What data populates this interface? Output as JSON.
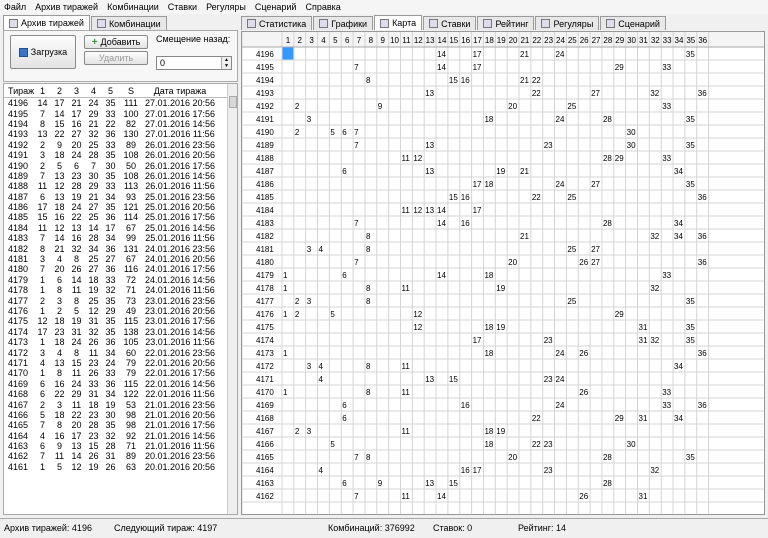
{
  "menu": [
    "Файл",
    "Архив тиражей",
    "Комбинации",
    "Ставки",
    "Регуляры",
    "Сценарий",
    "Справка"
  ],
  "left_tabs": [
    {
      "label": "Архив тиражей",
      "active": true
    },
    {
      "label": "Комбинации",
      "active": false
    }
  ],
  "toolbar": {
    "load_label": "Загрузка",
    "add_label": "Добавить",
    "delete_label": "Удалить",
    "offset_label": "Смещение назад:",
    "offset_value": "0"
  },
  "draw_header": [
    "Тираж",
    "1",
    "2",
    "3",
    "4",
    "5",
    "S",
    "Дата тиража"
  ],
  "draws": [
    [
      "4196",
      "14",
      "17",
      "21",
      "24",
      "35",
      "111",
      "27.01.2016 20:56"
    ],
    [
      "4195",
      "7",
      "14",
      "17",
      "29",
      "33",
      "100",
      "27.01.2016 17:56"
    ],
    [
      "4194",
      "8",
      "15",
      "16",
      "21",
      "22",
      "82",
      "27.01.2016 14:56"
    ],
    [
      "4193",
      "13",
      "22",
      "27",
      "32",
      "36",
      "130",
      "27.01.2016 11:56"
    ],
    [
      "4192",
      "2",
      "9",
      "20",
      "25",
      "33",
      "89",
      "26.01.2016 23:56"
    ],
    [
      "4191",
      "3",
      "18",
      "24",
      "28",
      "35",
      "108",
      "26.01.2016 20:56"
    ],
    [
      "4190",
      "2",
      "5",
      "6",
      "7",
      "30",
      "50",
      "26.01.2016 17:56"
    ],
    [
      "4189",
      "7",
      "13",
      "23",
      "30",
      "35",
      "108",
      "26.01.2016 14:56"
    ],
    [
      "4188",
      "11",
      "12",
      "28",
      "29",
      "33",
      "113",
      "26.01.2016 11:56"
    ],
    [
      "4187",
      "6",
      "13",
      "19",
      "21",
      "34",
      "93",
      "25.01.2016 23:56"
    ],
    [
      "4186",
      "17",
      "18",
      "24",
      "27",
      "35",
      "121",
      "25.01.2016 20:56"
    ],
    [
      "4185",
      "15",
      "16",
      "22",
      "25",
      "36",
      "114",
      "25.01.2016 17:56"
    ],
    [
      "4184",
      "11",
      "12",
      "13",
      "14",
      "17",
      "67",
      "25.01.2016 14:56"
    ],
    [
      "4183",
      "7",
      "14",
      "16",
      "28",
      "34",
      "99",
      "25.01.2016 11:56"
    ],
    [
      "4182",
      "8",
      "21",
      "32",
      "34",
      "36",
      "131",
      "24.01.2016 23:56"
    ],
    [
      "4181",
      "3",
      "4",
      "8",
      "25",
      "27",
      "67",
      "24.01.2016 20:56"
    ],
    [
      "4180",
      "7",
      "20",
      "26",
      "27",
      "36",
      "116",
      "24.01.2016 17:56"
    ],
    [
      "4179",
      "1",
      "6",
      "14",
      "18",
      "33",
      "72",
      "24.01.2016 14:56"
    ],
    [
      "4178",
      "1",
      "8",
      "11",
      "19",
      "32",
      "71",
      "24.01.2016 11:56"
    ],
    [
      "4177",
      "2",
      "3",
      "8",
      "25",
      "35",
      "73",
      "23.01.2016 23:56"
    ],
    [
      "4176",
      "1",
      "2",
      "5",
      "12",
      "29",
      "49",
      "23.01.2016 20:56"
    ],
    [
      "4175",
      "12",
      "18",
      "19",
      "31",
      "35",
      "115",
      "23.01.2016 17:56"
    ],
    [
      "4174",
      "17",
      "23",
      "31",
      "32",
      "35",
      "138",
      "23.01.2016 14:56"
    ],
    [
      "4173",
      "1",
      "18",
      "24",
      "26",
      "36",
      "105",
      "23.01.2016 11:56"
    ],
    [
      "4172",
      "3",
      "4",
      "8",
      "11",
      "34",
      "60",
      "22.01.2016 23:56"
    ],
    [
      "4171",
      "4",
      "13",
      "15",
      "23",
      "24",
      "79",
      "22.01.2016 20:56"
    ],
    [
      "4170",
      "1",
      "8",
      "11",
      "26",
      "33",
      "79",
      "22.01.2016 17:56"
    ],
    [
      "4169",
      "6",
      "16",
      "24",
      "33",
      "36",
      "115",
      "22.01.2016 14:56"
    ],
    [
      "4168",
      "6",
      "22",
      "29",
      "31",
      "34",
      "122",
      "22.01.2016 11:56"
    ],
    [
      "4167",
      "2",
      "3",
      "11",
      "18",
      "19",
      "53",
      "21.01.2016 23:56"
    ],
    [
      "4166",
      "5",
      "18",
      "22",
      "23",
      "30",
      "98",
      "21.01.2016 20:56"
    ],
    [
      "4165",
      "7",
      "8",
      "20",
      "28",
      "35",
      "98",
      "21.01.2016 17:56"
    ],
    [
      "4164",
      "4",
      "16",
      "17",
      "23",
      "32",
      "92",
      "21.01.2016 14:56"
    ],
    [
      "4163",
      "6",
      "9",
      "13",
      "15",
      "28",
      "71",
      "21.01.2016 11:56"
    ],
    [
      "4162",
      "7",
      "11",
      "14",
      "26",
      "31",
      "89",
      "20.01.2016 23:56"
    ],
    [
      "4161",
      "1",
      "5",
      "12",
      "19",
      "26",
      "63",
      "20.01.2016 20:56"
    ]
  ],
  "right_tabs": [
    {
      "label": "Статистика",
      "active": false
    },
    {
      "label": "Графики",
      "active": false
    },
    {
      "label": "Карта",
      "active": true
    },
    {
      "label": "Ставки",
      "active": false
    },
    {
      "label": "Рейтинг",
      "active": false
    },
    {
      "label": "Регуляры",
      "active": false
    },
    {
      "label": "Сценарий",
      "active": false
    }
  ],
  "map_columns": [
    "1",
    "2",
    "3",
    "4",
    "5",
    "6",
    "7",
    "8",
    "9",
    "10",
    "11",
    "12",
    "13",
    "14",
    "15",
    "16",
    "17",
    "18",
    "19",
    "20",
    "21",
    "22",
    "23",
    "24",
    "25",
    "26",
    "27",
    "28",
    "29",
    "30",
    "31",
    "32",
    "33",
    "34",
    "35",
    "36"
  ],
  "map_rows": [
    {
      "draw": "4196",
      "nums": [
        14,
        17,
        21,
        24,
        35
      ]
    },
    {
      "draw": "4195",
      "nums": [
        7,
        14,
        17,
        29,
        33
      ]
    },
    {
      "draw": "4194",
      "nums": [
        8,
        15,
        16,
        21,
        22
      ]
    },
    {
      "draw": "4193",
      "nums": [
        13,
        22,
        27,
        32,
        36
      ]
    },
    {
      "draw": "4192",
      "nums": [
        2,
        9,
        20,
        25,
        33
      ]
    },
    {
      "draw": "4191",
      "nums": [
        3,
        18,
        24,
        28,
        35
      ]
    },
    {
      "draw": "4190",
      "nums": [
        2,
        5,
        6,
        7,
        30
      ]
    },
    {
      "draw": "4189",
      "nums": [
        7,
        13,
        23,
        30,
        35
      ]
    },
    {
      "draw": "4188",
      "nums": [
        11,
        12,
        28,
        29,
        33
      ]
    },
    {
      "draw": "4187",
      "nums": [
        6,
        13,
        19,
        21,
        34
      ]
    },
    {
      "draw": "4186",
      "nums": [
        17,
        18,
        24,
        27,
        35
      ]
    },
    {
      "draw": "4185",
      "nums": [
        15,
        16,
        22,
        25,
        36
      ]
    },
    {
      "draw": "4184",
      "nums": [
        11,
        12,
        13,
        14,
        17
      ]
    },
    {
      "draw": "4183",
      "nums": [
        7,
        14,
        16,
        28,
        34
      ]
    },
    {
      "draw": "4182",
      "nums": [
        8,
        21,
        32,
        34,
        36
      ]
    },
    {
      "draw": "4181",
      "nums": [
        3,
        4,
        8,
        25,
        27
      ]
    },
    {
      "draw": "4180",
      "nums": [
        7,
        20,
        26,
        27,
        36
      ]
    },
    {
      "draw": "4179",
      "nums": [
        1,
        6,
        14,
        18,
        33
      ]
    },
    {
      "draw": "4178",
      "nums": [
        1,
        8,
        11,
        19,
        32
      ]
    },
    {
      "draw": "4177",
      "nums": [
        2,
        3,
        8,
        25,
        35
      ]
    },
    {
      "draw": "4176",
      "nums": [
        1,
        2,
        5,
        12,
        29
      ]
    },
    {
      "draw": "4175",
      "nums": [
        12,
        18,
        19,
        31,
        35
      ]
    },
    {
      "draw": "4174",
      "nums": [
        17,
        23,
        31,
        32,
        35
      ]
    },
    {
      "draw": "4173",
      "nums": [
        1,
        18,
        24,
        26,
        36
      ]
    },
    {
      "draw": "4172",
      "nums": [
        3,
        4,
        8,
        11,
        34
      ]
    },
    {
      "draw": "4171",
      "nums": [
        4,
        13,
        15,
        23,
        24
      ]
    },
    {
      "draw": "4170",
      "nums": [
        1,
        8,
        11,
        26,
        33
      ]
    },
    {
      "draw": "4169",
      "nums": [
        6,
        16,
        24,
        33,
        36
      ]
    },
    {
      "draw": "4168",
      "nums": [
        6,
        22,
        29,
        31,
        34
      ]
    },
    {
      "draw": "4167",
      "nums": [
        2,
        3,
        11,
        18,
        19
      ]
    },
    {
      "draw": "4166",
      "nums": [
        5,
        18,
        22,
        23,
        30
      ]
    },
    {
      "draw": "4165",
      "nums": [
        7,
        8,
        20,
        28,
        35
      ]
    },
    {
      "draw": "4164",
      "nums": [
        4,
        16,
        17,
        23,
        32
      ]
    },
    {
      "draw": "4163",
      "nums": [
        6,
        9,
        13,
        15,
        28
      ]
    },
    {
      "draw": "4162",
      "nums": [
        7,
        11,
        14,
        26,
        31
      ]
    }
  ],
  "status": {
    "archive": "Архив тиражей: 4196",
    "next": "Следующий тираж: 4197",
    "combos": "Комбинаций: 376992",
    "bets": "Ставок: 0",
    "rating": "Рейтинг: 14"
  },
  "colors": {
    "selected_cell": "#3399ff",
    "grid_line": "#d4d4d4",
    "header_bg": "#f4f4f4"
  }
}
